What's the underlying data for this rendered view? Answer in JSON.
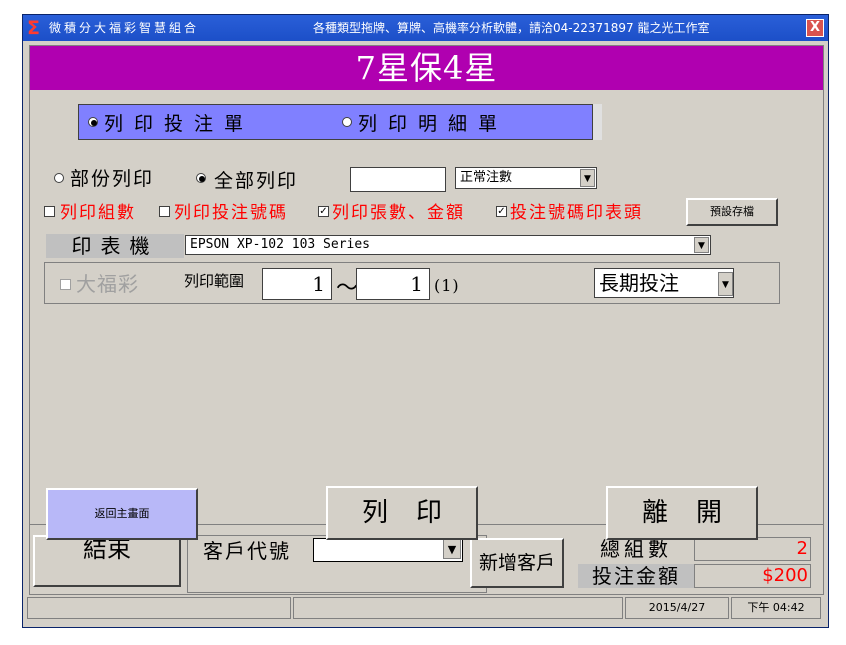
{
  "window": {
    "title_icon": "Σ",
    "title": "微積分大福彩智慧組合",
    "title_info": "各種類型拖牌、算牌、高機率分析軟體，請洽04-22371897 龍之光工作室",
    "close_label": "X"
  },
  "dialog": {
    "title": "7星保4星",
    "print_mode": {
      "ticket_label": "列印投注單",
      "detail_label": "列印明細單",
      "selected": "ticket"
    },
    "scope": {
      "partial_label": "部份列印",
      "all_label": "全部列印",
      "selected": "all",
      "count_value": "",
      "mode_select_value": "正常注數"
    },
    "options": [
      {
        "label": "列印組數",
        "checked": false
      },
      {
        "label": "列印投注號碼",
        "checked": false
      },
      {
        "label": "列印張數、金額",
        "checked": true
      },
      {
        "label": "投注號碼印表頭",
        "checked": true
      }
    ],
    "save_default_label": "預設存檔",
    "printer": {
      "label": "印表機",
      "value": "EPSON XP-102 103 Series"
    },
    "range": {
      "lotto_label": "大福彩",
      "lotto_checked": false,
      "label": "列印範圍",
      "from": "1",
      "tilde": "～",
      "to": "1",
      "count": "(1)",
      "term_value": "長期投注"
    },
    "back_label": "返回主畫面",
    "print_label": "列印",
    "exit_label": "離開"
  },
  "main": {
    "end_label": "結束",
    "customer_label": "客戶代號",
    "customer_value": "",
    "add_customer_label": "新增客戶",
    "total_count_label": "總組數",
    "total_count_value": "2",
    "bet_amount_label": "投注金額",
    "bet_amount_value": "$200"
  },
  "status": {
    "date": "2015/4/27",
    "time": "下午 04:42"
  },
  "colors": {
    "title_bar": "#1c4fc8",
    "dialog_title": "#b000b0",
    "mode_panel": "#8080ff",
    "option_text": "#ff0000",
    "back_button": "#b8b8f8"
  }
}
